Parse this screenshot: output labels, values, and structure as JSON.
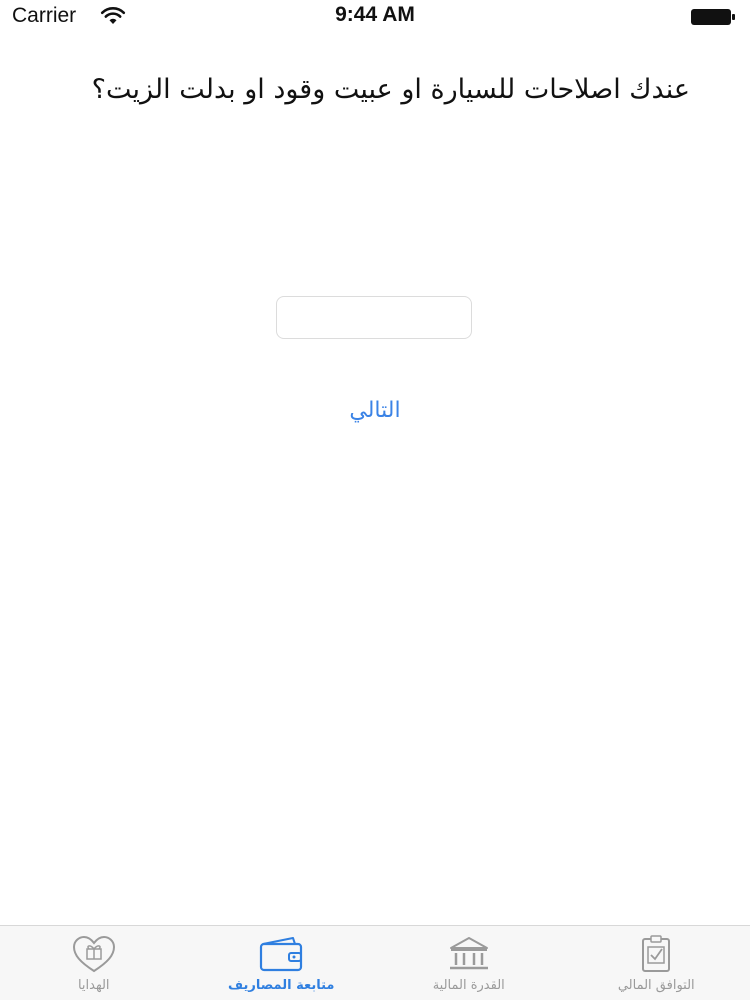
{
  "status_bar": {
    "carrier": "Carrier",
    "time": "9:44 AM"
  },
  "question": {
    "text": "عندك اصلاحات للسيارة او عبيت وقود او بدلت الزيت؟"
  },
  "answer_input": {
    "value": "",
    "placeholder": ""
  },
  "next_button": {
    "label": "التالي"
  },
  "tab_bar": {
    "active_index": 2,
    "tabs": [
      {
        "label": "الهدايا",
        "icon": "gift-heart-icon"
      },
      {
        "label": "متابعة المصاريف",
        "icon": "wallet-icon"
      },
      {
        "label": "القدرة المالية",
        "icon": "bank-icon"
      },
      {
        "label": "التوافق المالي",
        "icon": "checklist-icon"
      }
    ]
  },
  "colors": {
    "accent": "#2f7fe0",
    "inactive": "#9a9a9a",
    "tab_bar_bg": "#f7f7f7"
  }
}
